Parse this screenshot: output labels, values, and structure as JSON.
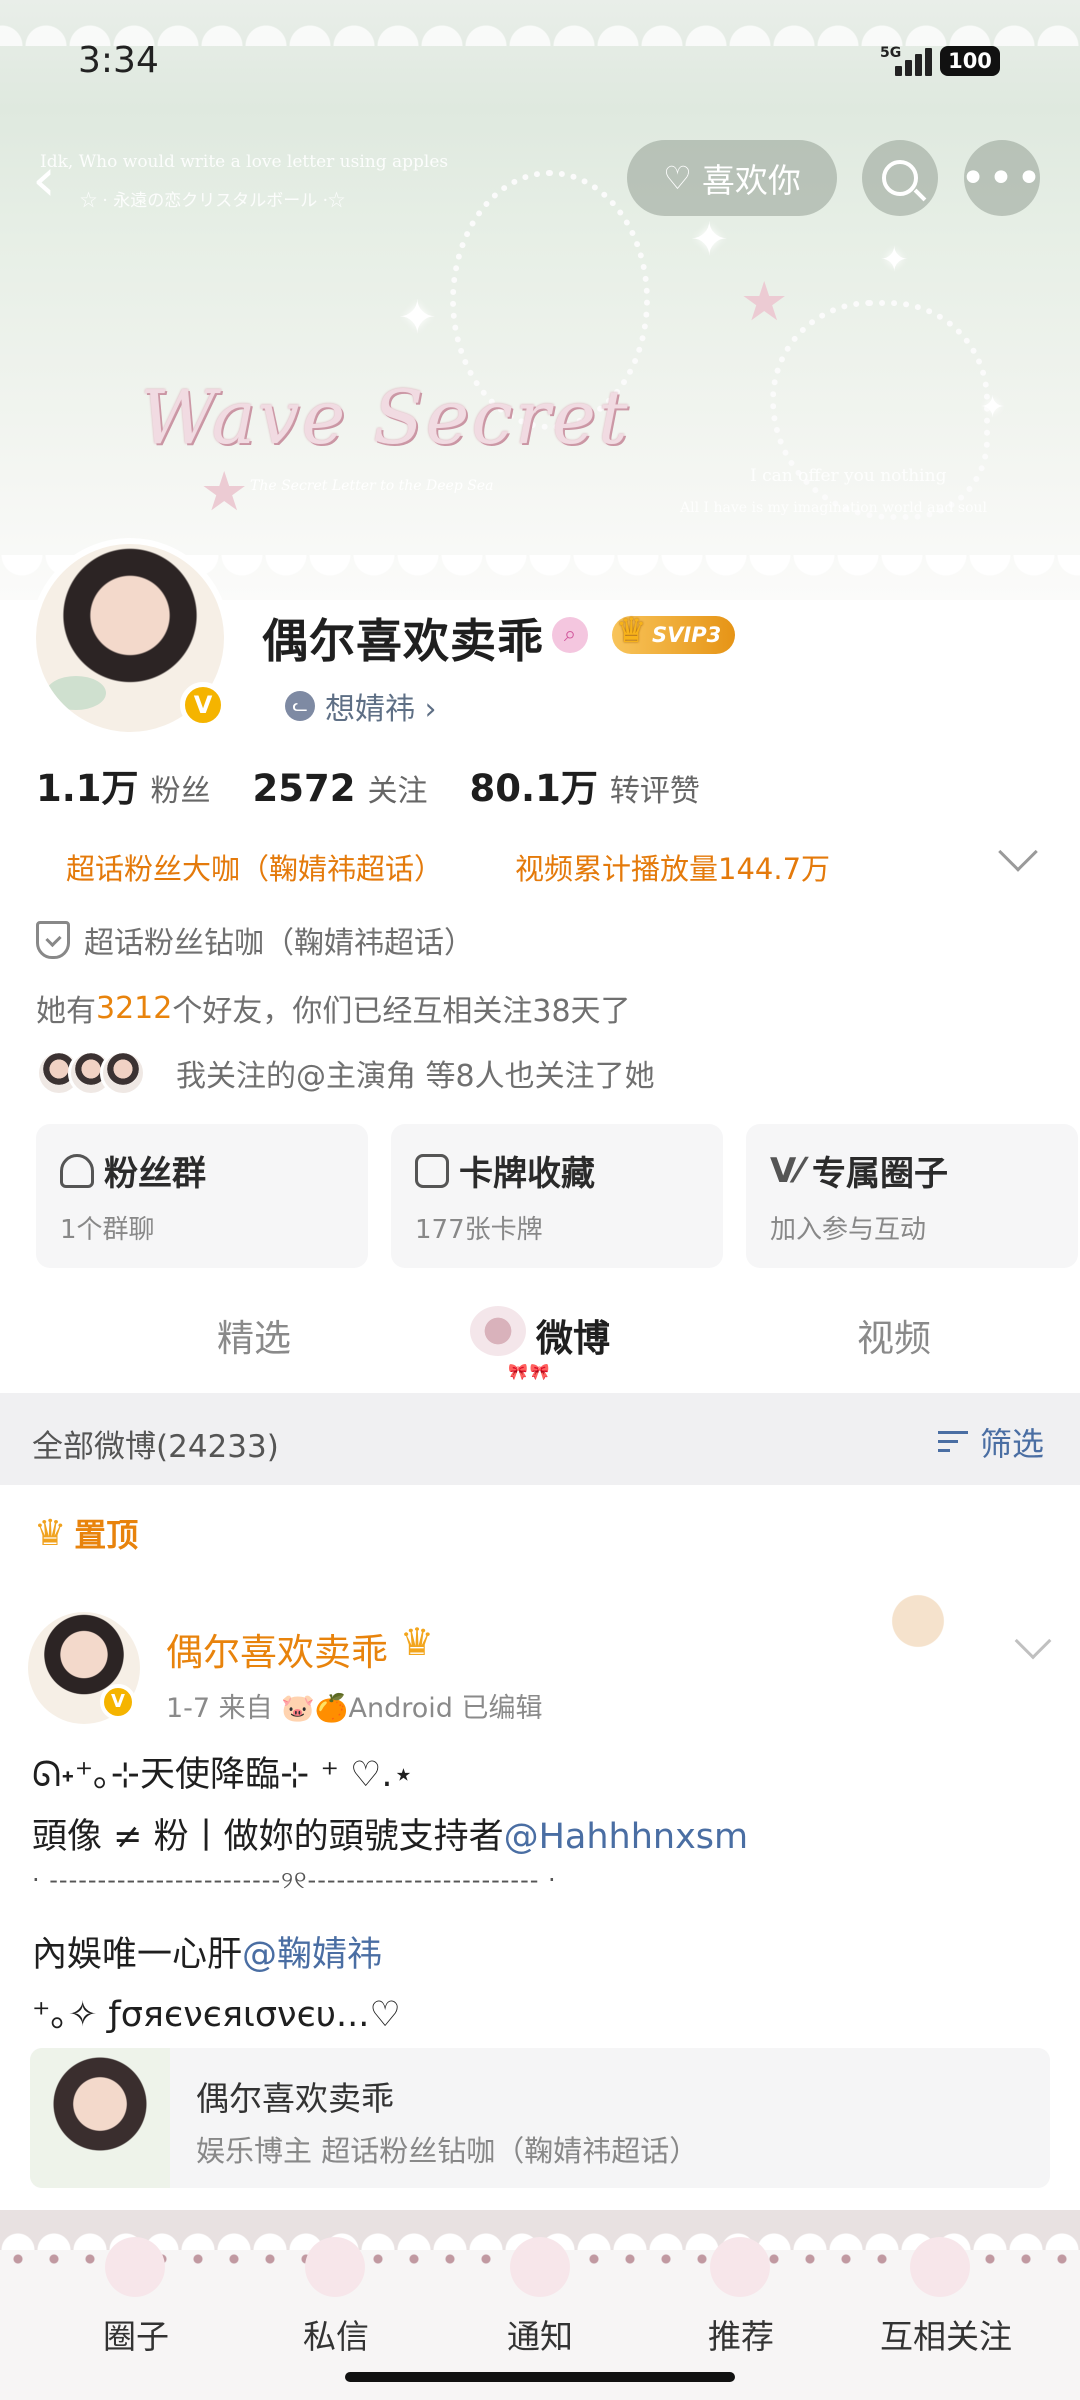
{
  "status_bar": {
    "time": "3:34",
    "network": "5G",
    "battery": "100"
  },
  "header": {
    "like_button": "喜欢你",
    "banner_text_1": "Idk, Who would write a love letter using apples",
    "banner_text_2": "☆ · 永遠の恋クリスタルボール ·☆",
    "banner_logo": "Wave Secret",
    "banner_logo_sub": "The Secret Letter to the Deep Sea",
    "banner_right_1": "I can offer you nothing",
    "banner_right_2": "All I have is my imagination world and soul"
  },
  "profile": {
    "name": "偶尔喜欢卖乖",
    "vip_badge": "SVIP3",
    "sub_account": "想婧祎 ›",
    "stats": [
      {
        "num": "1.1万",
        "label": "粉丝"
      },
      {
        "num": "2572",
        "label": "关注"
      },
      {
        "num": "80.1万",
        "label": "转评赞"
      }
    ],
    "highlight_1": "超话粉丝大咖（鞠婧祎超话）",
    "highlight_2": "视频累计播放量144.7万",
    "honor": "超话粉丝钻咖（鞠婧祎超话）",
    "friends_prefix": "她有 ",
    "friends_count": "3212",
    "friends_suffix": " 个好友，你们已经互相关注38天了",
    "mutual_text": "我关注的@主演角 等8人也关注了她"
  },
  "cards": [
    {
      "title": "粉丝群",
      "sub": "1个群聊"
    },
    {
      "title": "卡牌收藏",
      "sub": "177张卡牌"
    },
    {
      "title": "专属圈子",
      "sub": "加入参与互动"
    }
  ],
  "tabs": [
    {
      "label": "精选"
    },
    {
      "label": "微博"
    },
    {
      "label": "视频"
    }
  ],
  "feed": {
    "count_label": "全部微博(24233)",
    "filter_label": "筛选",
    "pinned_label": "置顶"
  },
  "post": {
    "author": "偶尔喜欢卖乖",
    "meta": "1-7  来自 🐷🍊Android  已编辑",
    "line1": "ᘏ˖⁺｡⊹天使降臨⊹ ⁺ ♡.⋆",
    "line2_text": "頭像 ≠ 粉丨做妳的頭號支持者",
    "line2_link": "@Hahhhnxsm",
    "separator": "· ------------------------୨୧------------------------ ·",
    "line3_text": "內娛唯一心肝",
    "line3_link": "@鞠婧祎",
    "line4": "⁺｡✧ ƒσяєνєяισνєυ...♡",
    "card_name": "偶尔喜欢卖乖",
    "card_desc": "娱乐博主 超话粉丝钻咖（鞠婧祎超话）"
  },
  "bottom_nav": [
    {
      "label": "圈子"
    },
    {
      "label": "私信"
    },
    {
      "label": "通知"
    },
    {
      "label": "推荐"
    },
    {
      "label": "互相关注"
    }
  ],
  "colors": {
    "accent_orange": "#e8830c",
    "link_blue": "#4a6ea3",
    "vip_gold": "#f5b400"
  }
}
